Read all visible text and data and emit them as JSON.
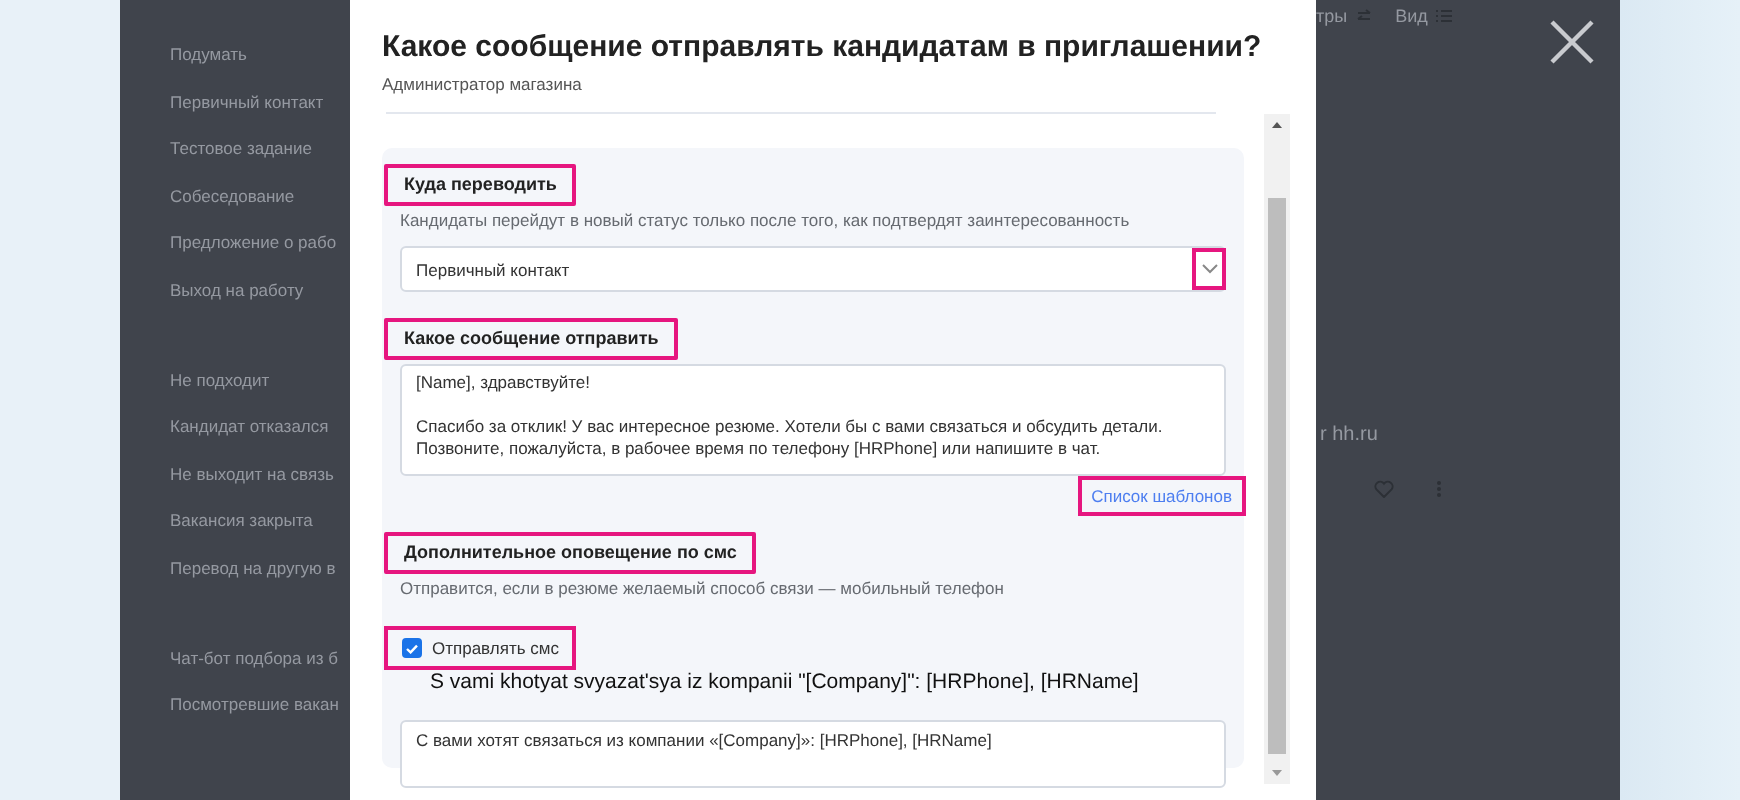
{
  "background_page": {
    "toolbar": [
      {
        "kind": "filter",
        "label": "тры"
      },
      {
        "kind": "view",
        "label": "Вид"
      }
    ],
    "status_groups": [
      {
        "items": [
          "Подумать",
          "Первичный контакт",
          "Тестовое задание",
          "Собеседование",
          "Предложение о рабо",
          "Выход на работу"
        ]
      },
      {
        "items": [
          "Не подходит",
          "Кандидат отказался",
          "Не выходит на связь",
          "Вакансия закрыта",
          "Перевод на другую в"
        ]
      },
      {
        "items": [
          "Чат-бот подбора из б",
          "Посмотревшие вакан"
        ]
      }
    ],
    "snippet": "r hh.ru"
  },
  "dialog": {
    "title": "Какое сообщение отправлять кандидатам в приглашении?",
    "subtitle": "Администратор магазина",
    "sections": [
      {
        "kind": "select",
        "label": "Куда переводить",
        "label_highlighted": true,
        "hint": "Кандидаты перейдут в новый статус только после того, как подтвердят заинтересованность",
        "value": "Первичный контакт",
        "chevron_highlighted": true
      },
      {
        "kind": "message",
        "label": "Какое сообщение отправить",
        "label_highlighted": true,
        "value": "[Name], здравствуйте!\n\nСпасибо за отклик! У вас интересное резюме. Хотели бы с вами связаться и обсудить детали.\nПозвоните, пожалуйста, в рабочее время по телефону [HRPhone] или напишите в чат.",
        "link": {
          "text": "Список шаблонов",
          "highlighted": true
        }
      },
      {
        "kind": "sms",
        "label": "Дополнительное оповещение по смс",
        "label_highlighted": true,
        "hint": "Отправится, если в резюме желаемый способ связи — мобильный телефон",
        "checkbox": {
          "label": "Отправлять смс",
          "checked": true,
          "highlighted": true
        },
        "caption": "S vami khotyat svyazat'sya iz kompanii \"[Company]\": [HRPhone], [HRName]",
        "value": "С вами хотят связаться из компании «[Company]»: [HRPhone], [HRName]"
      }
    ]
  }
}
